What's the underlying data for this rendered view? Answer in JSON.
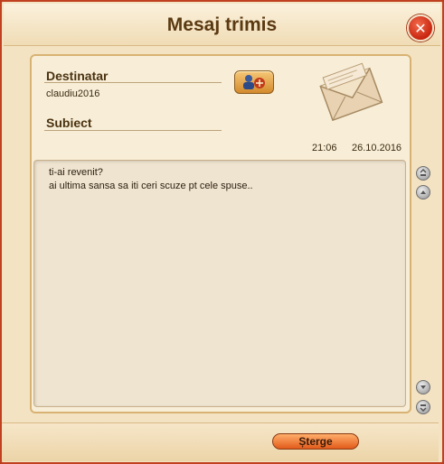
{
  "window": {
    "title": "Mesaj trimis"
  },
  "header": {
    "recipient_label": "Destinatar",
    "recipient_value": "claudiu2016",
    "subject_label": "Subiect",
    "subject_value": "",
    "time": "21:06",
    "date": "26.10.2016"
  },
  "message": {
    "lines": [
      "ti-ai revenit?",
      "ai ultima sansa sa iti ceri scuze pt cele spuse.."
    ]
  },
  "footer": {
    "delete_label": "Șterge"
  },
  "icons": {
    "close": "close-icon",
    "contact": "add-contact-icon",
    "envelope": "envelope-icon",
    "scroll_top": "scroll-top-icon",
    "scroll_up": "scroll-up-icon",
    "scroll_down": "scroll-down-icon",
    "scroll_bottom": "scroll-bottom-icon"
  },
  "colors": {
    "frame": "#c0401f",
    "panel": "#f8eed8",
    "delete_button": "#e25b1b"
  }
}
